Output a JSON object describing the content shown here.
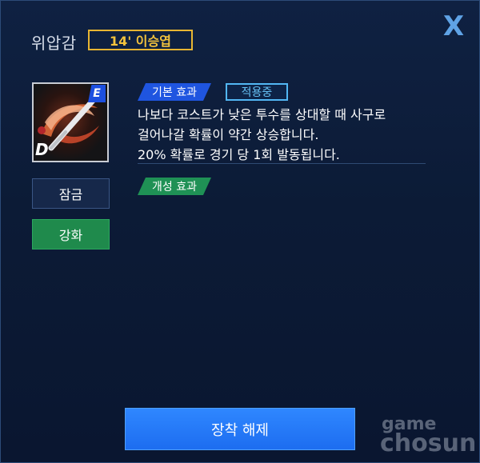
{
  "dialog": {
    "title": "위압감",
    "player_badge": "14' 이승엽",
    "close_label": "X"
  },
  "card": {
    "grade_top": "E",
    "grade_bottom": "D",
    "icon": "baseball-bat-swing-icon",
    "accent_color": "#e06a3a"
  },
  "side_buttons": {
    "lock_label": "잠금",
    "upgrade_label": "강화"
  },
  "effects": {
    "basic_tag": "기본 효과",
    "status_tag": "적용중",
    "description": [
      "나보다 코스트가 낮은 투수를 상대할 때 사구로",
      "걸어나갈 확률이 약간 상승합니다.",
      "20% 확률로 경기 당 1회 발동됩니다."
    ],
    "trait_tag": "개성 효과"
  },
  "footer": {
    "unequip_label": "장착 해제"
  },
  "watermark": {
    "line1": "game",
    "line2": "chosun"
  },
  "colors": {
    "background": "#0b1830",
    "badge_gold": "#e7b532",
    "basic_blue": "#1f55e0",
    "active_cyan": "#52b7f4",
    "trait_green": "#1f9155",
    "unequip_blue": "#2f87ff",
    "close_blue": "#5fa3e6"
  }
}
